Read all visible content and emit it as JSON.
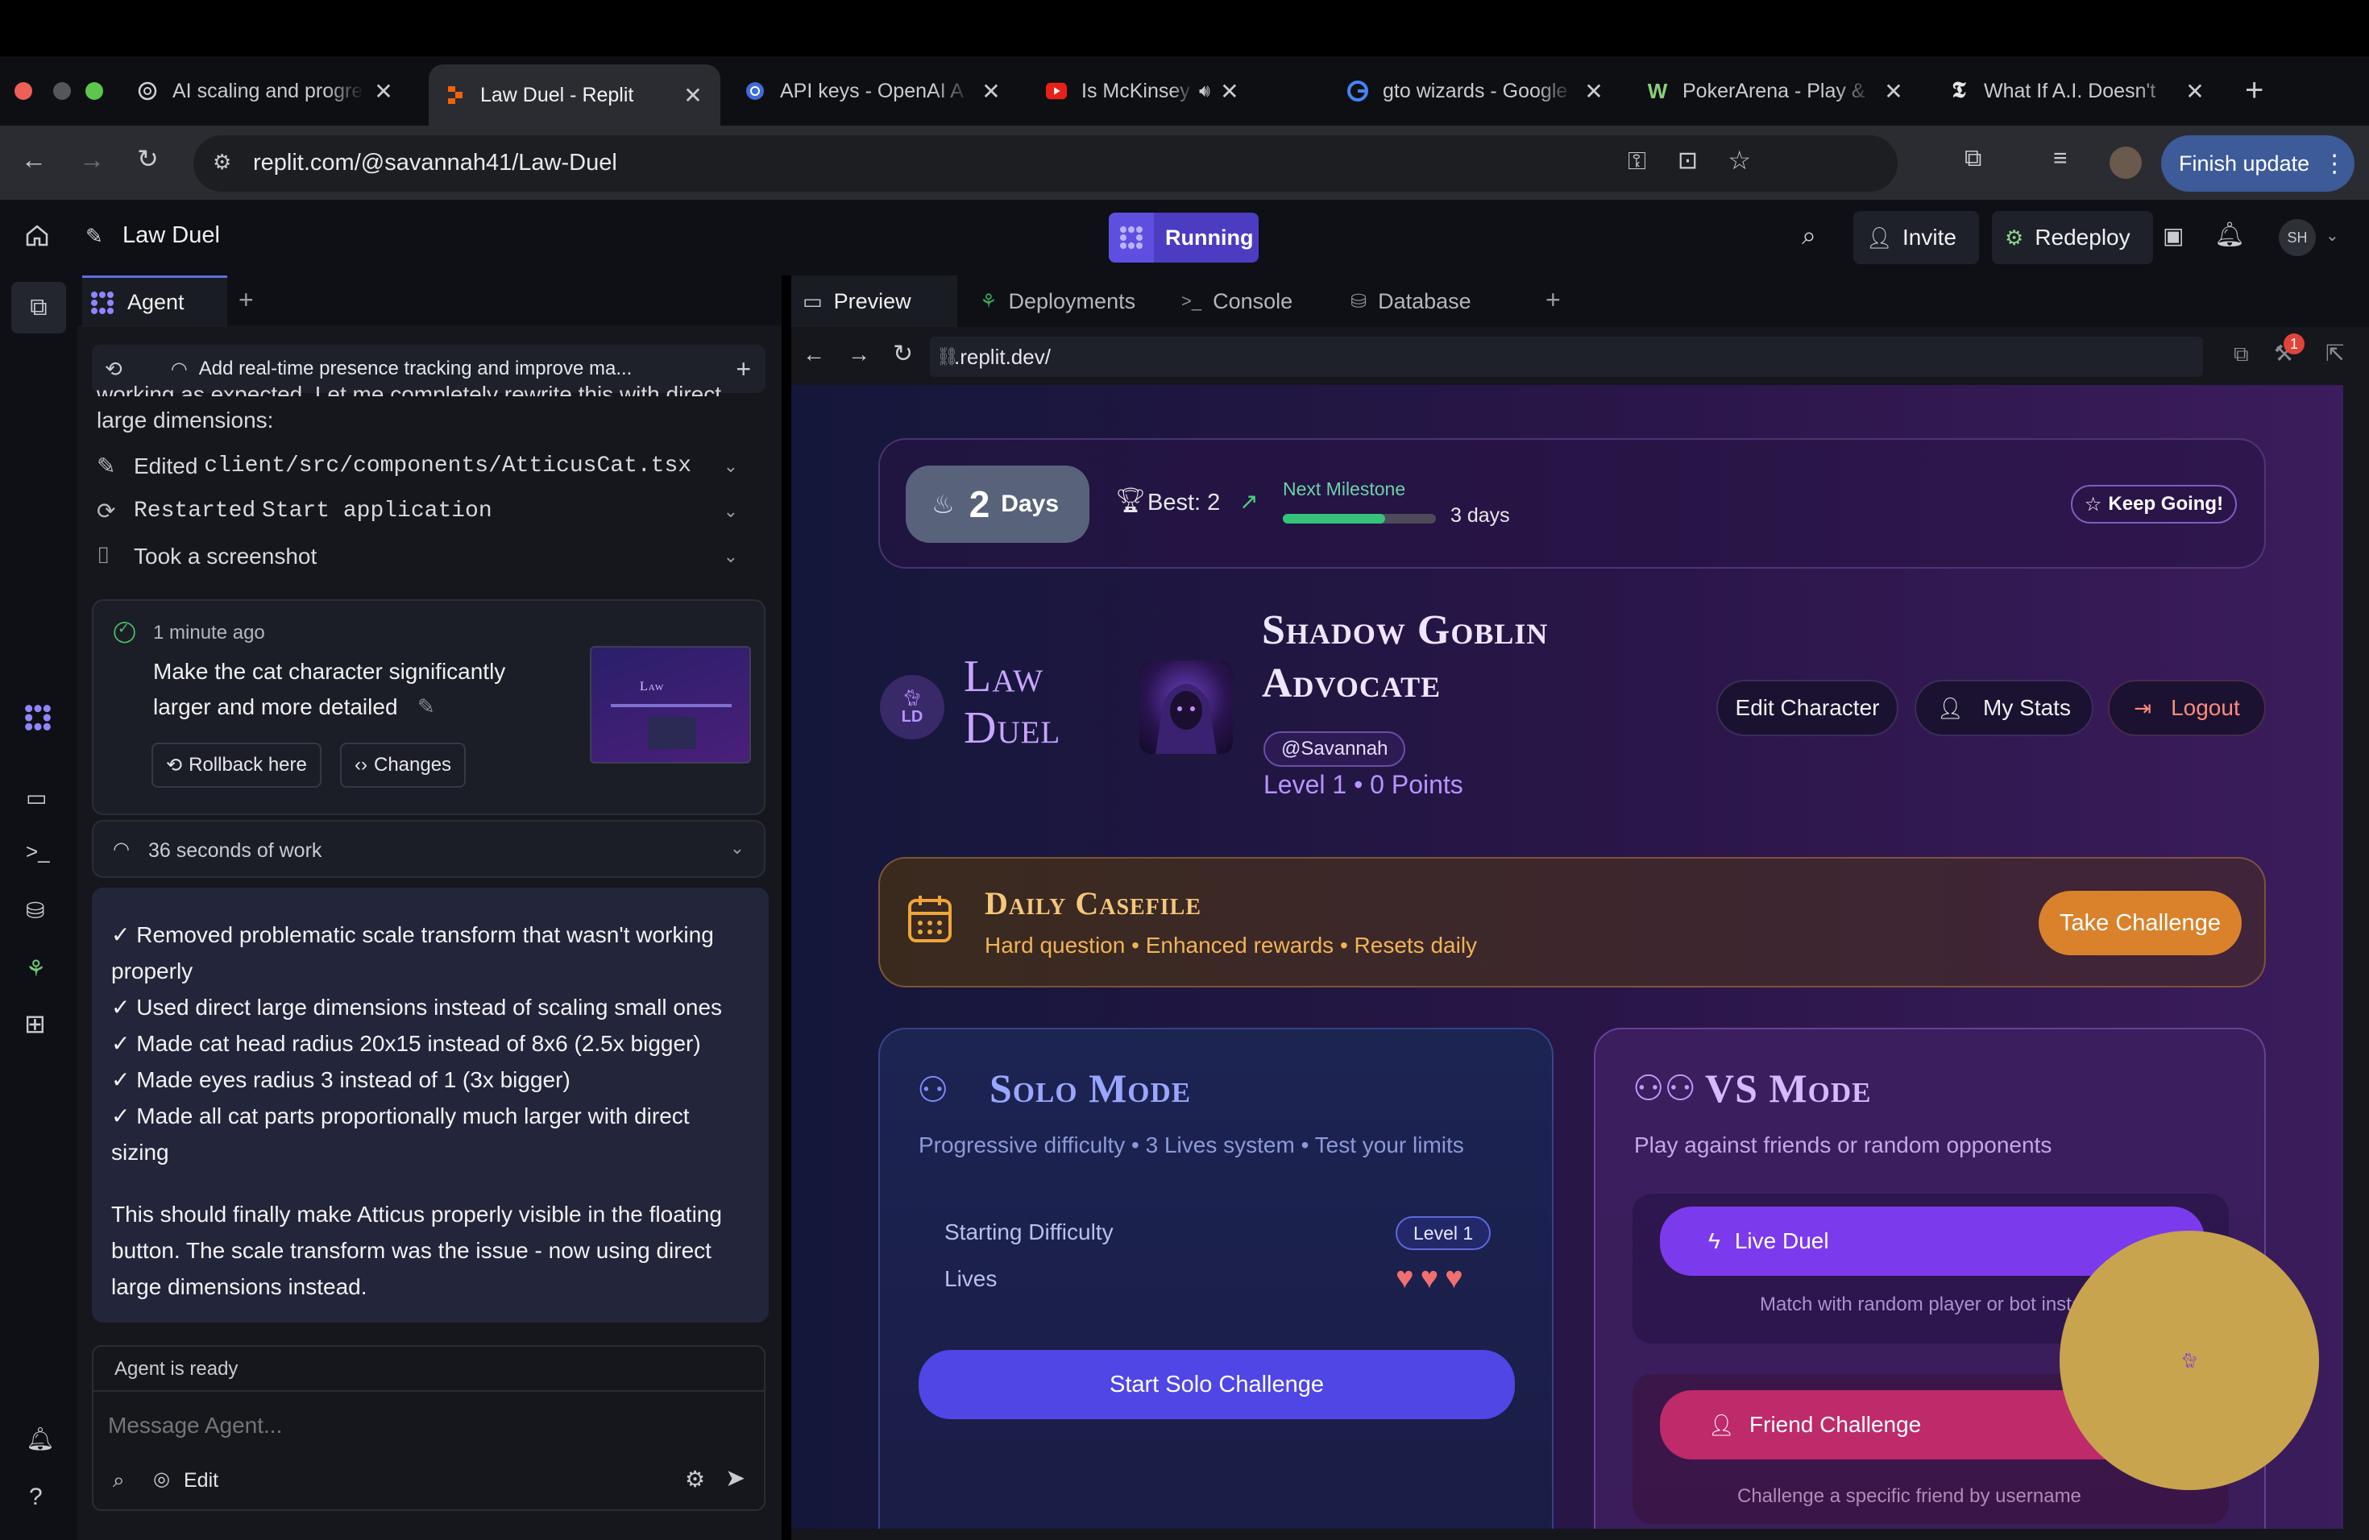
{
  "browser": {
    "tabs": [
      {
        "title": "AI scaling and progre",
        "active": false
      },
      {
        "title": "Law Duel - Replit",
        "active": true
      },
      {
        "title": "API keys - OpenAI A",
        "active": false
      },
      {
        "title": "Is McKinsey losin",
        "active": false
      },
      {
        "title": "gto wizards - Google",
        "active": false
      },
      {
        "title": "PokerArena - Play &",
        "active": false
      },
      {
        "title": "What If A.I. Doesn't",
        "active": false
      }
    ],
    "url": "replit.com/@savannah41/Law-Duel",
    "finish_update": "Finish update"
  },
  "replit": {
    "project_name": "Law Duel",
    "run_status": "Running",
    "invite": "Invite",
    "redeploy": "Redeploy",
    "avatar_initials": "SH"
  },
  "agent": {
    "tab_label": "Agent",
    "thread_title": "Add real-time presence tracking and improve ma...",
    "truncated_text": "working as expected. Let me completely rewrite this with direct",
    "large_dims": "large dimensions:",
    "tool_lines": [
      {
        "prefix": "Edited",
        "code": "client/src/components/AtticusCat.tsx"
      },
      {
        "prefix": "Restarted",
        "code": "Start application"
      },
      {
        "prefix": "Took a screenshot",
        "code": ""
      }
    ],
    "checkpoint": {
      "time": "1 minute ago",
      "message_line1": "Make the cat character significantly",
      "message_line2": "larger and more detailed",
      "rollback": "Rollback here",
      "changes": "Changes"
    },
    "work_summary": "36 seconds of work",
    "response_lines": [
      "✓ Removed problematic scale transform that wasn't working",
      "properly",
      "✓ Used direct large dimensions instead of scaling small ones",
      "✓ Made cat head radius 20x15 instead of 8x6 (2.5x bigger)",
      "✓ Made eyes radius 3 instead of 1 (3x bigger)",
      "✓ Made all cat parts proportionally much larger with direct",
      "sizing"
    ],
    "response_para": [
      "This should finally make Atticus properly visible in the floating",
      "button. The scale transform was the issue - now using direct",
      "large dimensions instead."
    ],
    "status": "Agent is ready",
    "input_placeholder": "Message Agent...",
    "edit_label": "Edit"
  },
  "panels": {
    "tabs": [
      "Preview",
      "Deployments",
      "Console",
      "Database"
    ],
    "preview_url": ".replit.dev/",
    "notification_count": "1"
  },
  "app": {
    "streak": {
      "days_num": "2",
      "days_label": "Days",
      "best": "Best: 2",
      "next_label": "Next Milestone",
      "next_value": "3 days",
      "progress": 0.67,
      "keep_going": "Keep Going!"
    },
    "logo_badge": "LD",
    "logo_line1": "Law",
    "logo_line2": "Duel",
    "character_line1": "Shadow Goblin",
    "character_line2": "Advocate",
    "username": "@Savannah",
    "level_points": "Level 1 • 0 Points",
    "edit_character": "Edit Character",
    "my_stats": "My Stats",
    "logout": "Logout",
    "daily": {
      "title": "Daily Casefile",
      "subtitle": "Hard question • Enhanced rewards • Resets daily",
      "button": "Take Challenge"
    },
    "solo": {
      "title": "Solo Mode",
      "subtitle": "Progressive difficulty • 3 Lives system • Test your limits",
      "starting_difficulty": "Starting Difficulty",
      "level_badge": "Level 1",
      "lives": "Lives",
      "hearts": 3,
      "button": "Start Solo Challenge"
    },
    "vs": {
      "title": "VS Mode",
      "subtitle": "Play against friends or random opponents",
      "live_duel": "Live Duel",
      "live_desc": "Match with random player or bot insta",
      "friend_challenge": "Friend Challenge",
      "friend_desc": "Challenge a specific friend by username"
    }
  },
  "colors": {
    "accent_purple": "#7c3aed",
    "solo_button": "#4f46e5",
    "orange": "#d9822b",
    "friend_pink": "#be2a6a",
    "floating_gold": "#c8a44e"
  }
}
